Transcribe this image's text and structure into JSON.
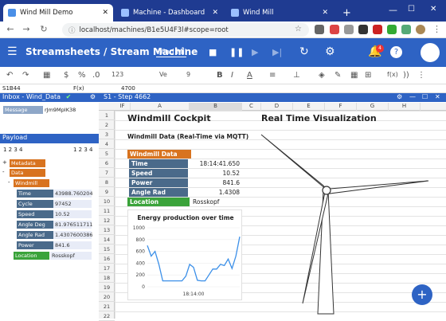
{
  "browser": {
    "tabs": [
      {
        "label": "Wind Mill Demo"
      },
      {
        "label": "Machine - Dashboard"
      },
      {
        "label": "Wind Mill"
      }
    ],
    "url": "localhost/machines/B1e5U4F3l#scope=root"
  },
  "app": {
    "title": "Streamsheets / Stream Machine",
    "machine_name": "Wind Mil",
    "notification_count": "4",
    "colors": {
      "primary": "#2e63c4",
      "orange": "#d8731f",
      "green": "#3aa33a",
      "slate": "#4a6a8a"
    }
  },
  "toolbar": {
    "font_size": "123",
    "font": "Ve",
    "size": "9"
  },
  "formula": {
    "cell_ref": "S1B44",
    "fx": "F(x)",
    "value": "4700"
  },
  "inbox": {
    "title": "Inbox - Wind_Data",
    "message_label": "Message",
    "message_id": "rJm9MpIK38"
  },
  "payload": {
    "title": "Payload",
    "pager_left": "1 2 3 4",
    "pager_right": "1 2 3 4",
    "tree": {
      "metadata": "Metadata",
      "data": "Data",
      "windmill_data": "Windmill Data",
      "fields": [
        {
          "label": "Time",
          "value": "43988.760204"
        },
        {
          "label": "Cycle",
          "value": "97452"
        },
        {
          "label": "Speed",
          "value": "10.52"
        },
        {
          "label": "Angle Deg",
          "value": "81.976511711"
        },
        {
          "label": "Angle Rad",
          "value": "1.4307600386"
        },
        {
          "label": "Power",
          "value": "841.6"
        }
      ],
      "location_label": "Location",
      "location_value": "Rosskopf"
    }
  },
  "sheet": {
    "title": "S1 - Step 4662",
    "columns": [
      "IF",
      "A",
      "B",
      "C",
      "D",
      "E",
      "F",
      "G",
      "H"
    ],
    "rows": [
      "1",
      "2",
      "3",
      "4",
      "5",
      "6",
      "7",
      "8",
      "9",
      "10",
      "11",
      "12",
      "13",
      "14",
      "15",
      "16",
      "17",
      "18",
      "19",
      "20",
      "21",
      "22"
    ],
    "cockpit_title": "Windmill Cockpit",
    "subtitle": "Windmill Data (Real-Time via MQTT)",
    "section": "Windmill Data",
    "fields": [
      {
        "label": "Time",
        "value": "18:14:41.650"
      },
      {
        "label": "Speed",
        "value": "10.52"
      },
      {
        "label": "Power",
        "value": "841.6"
      },
      {
        "label": "Angle Rad",
        "value": "1.4308"
      }
    ],
    "location_label": "Location",
    "location_value": "Rosskopf",
    "viz_title": "Real Time Visualization"
  },
  "chart_data": {
    "type": "line",
    "title": "Energy production over time",
    "xlabel": "",
    "ylabel": "",
    "ylim": [
      0,
      1000
    ],
    "y_ticks": [
      "1000",
      "800",
      "600",
      "400",
      "200",
      "0"
    ],
    "x_tick_label": "18:14:00",
    "series": [
      {
        "values": [
          700,
          520,
          600,
          380,
          100,
          100,
          100,
          100,
          100,
          100,
          180,
          380,
          330,
          110,
          100,
          100,
          200,
          300,
          300,
          380,
          360,
          470,
          310,
          520,
          850
        ]
      }
    ]
  }
}
